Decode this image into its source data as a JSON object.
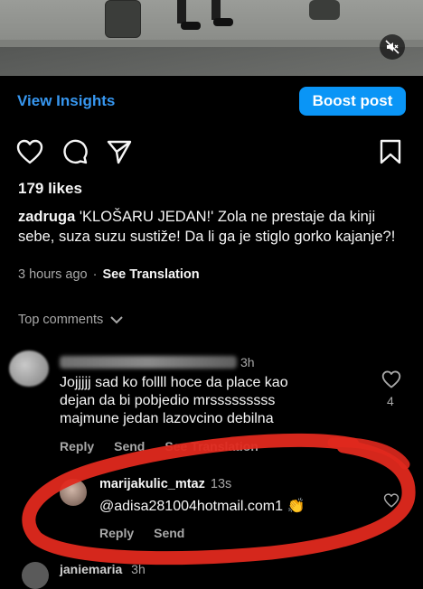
{
  "media": {
    "mute_icon": "speaker-muted-icon"
  },
  "header": {
    "insights_label": "View Insights",
    "boost_label": "Boost post",
    "accent_color": "#0a95f6"
  },
  "actions": {
    "like_icon": "heart-icon",
    "comment_icon": "comment-bubble-icon",
    "share_icon": "paper-plane-icon",
    "save_icon": "bookmark-icon"
  },
  "post": {
    "likes": "179 likes",
    "username": "zadruga",
    "caption": "'KLOŠARU JEDAN!' Zola ne prestaje da kinji sebe, suza suzu sustiže! Da li ga je stiglo gorko kajanje?!",
    "time": "3 hours ago",
    "see_translation": "See Translation"
  },
  "comments_header": {
    "label": "Top comments"
  },
  "comments": [
    {
      "time": "3h",
      "text_lines": [
        "Jojjjjj sad ko follll hoce da place kao",
        "dejan da bi pobjedio mrsssssssss",
        "majmune jedan lazovcino debilna"
      ],
      "likes": "4",
      "reply_label": "Reply",
      "send_label": "Send",
      "translate_label": "See Translation"
    },
    {
      "username": "marijakulic_mtaz",
      "time": "13s",
      "text": "@adisa281004hotmail.com1 👏",
      "reply_label": "Reply",
      "send_label": "Send"
    },
    {
      "username": "janiemaria",
      "time": "3h"
    }
  ],
  "annotation": {
    "color": "#e0291e"
  }
}
